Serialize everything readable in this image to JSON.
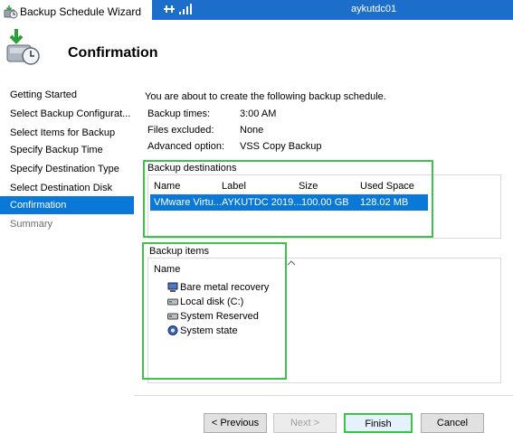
{
  "window": {
    "title": "Backup Schedule Wizard"
  },
  "remote_bar": {
    "host": "aykutdc01"
  },
  "header": {
    "title": "Confirmation"
  },
  "nav": {
    "items": [
      {
        "label": "Getting Started"
      },
      {
        "label": "Select Backup Configurat..."
      },
      {
        "label": "Select Items for Backup"
      },
      {
        "label": "Specify Backup Time"
      },
      {
        "label": "Specify Destination Type"
      },
      {
        "label": "Select Destination Disk"
      },
      {
        "label": "Confirmation"
      },
      {
        "label": "Summary"
      }
    ],
    "active_index": 6
  },
  "summary": {
    "intro": "You are about to create the following backup schedule.",
    "rows": [
      {
        "label": "Backup times:",
        "value": "3:00 AM"
      },
      {
        "label": "Files excluded:",
        "value": "None"
      },
      {
        "label": "Advanced option:",
        "value": "VSS Copy Backup"
      }
    ]
  },
  "destinations": {
    "title": "Backup destinations",
    "columns": [
      "Name",
      "Label",
      "Size",
      "Used Space"
    ],
    "rows": [
      {
        "name": "VMware Virtu...",
        "label": "AYKUTDC 2019...",
        "size": "100.00 GB",
        "used": "128.02 MB"
      }
    ]
  },
  "items": {
    "title": "Backup items",
    "column": "Name",
    "list": [
      {
        "label": "Bare metal recovery",
        "icon": "bare-metal-recovery-icon"
      },
      {
        "label": "Local disk (C:)",
        "icon": "local-disk-icon"
      },
      {
        "label": "System Reserved",
        "icon": "system-reserved-disk-icon"
      },
      {
        "label": "System state",
        "icon": "system-state-icon"
      }
    ]
  },
  "buttons": {
    "previous": "< Previous",
    "next": "Next >",
    "finish": "Finish",
    "cancel": "Cancel"
  },
  "colors": {
    "accent": "#0a78d7",
    "remote_bar": "#1d6ecb",
    "highlight_border": "#3ec24a"
  }
}
